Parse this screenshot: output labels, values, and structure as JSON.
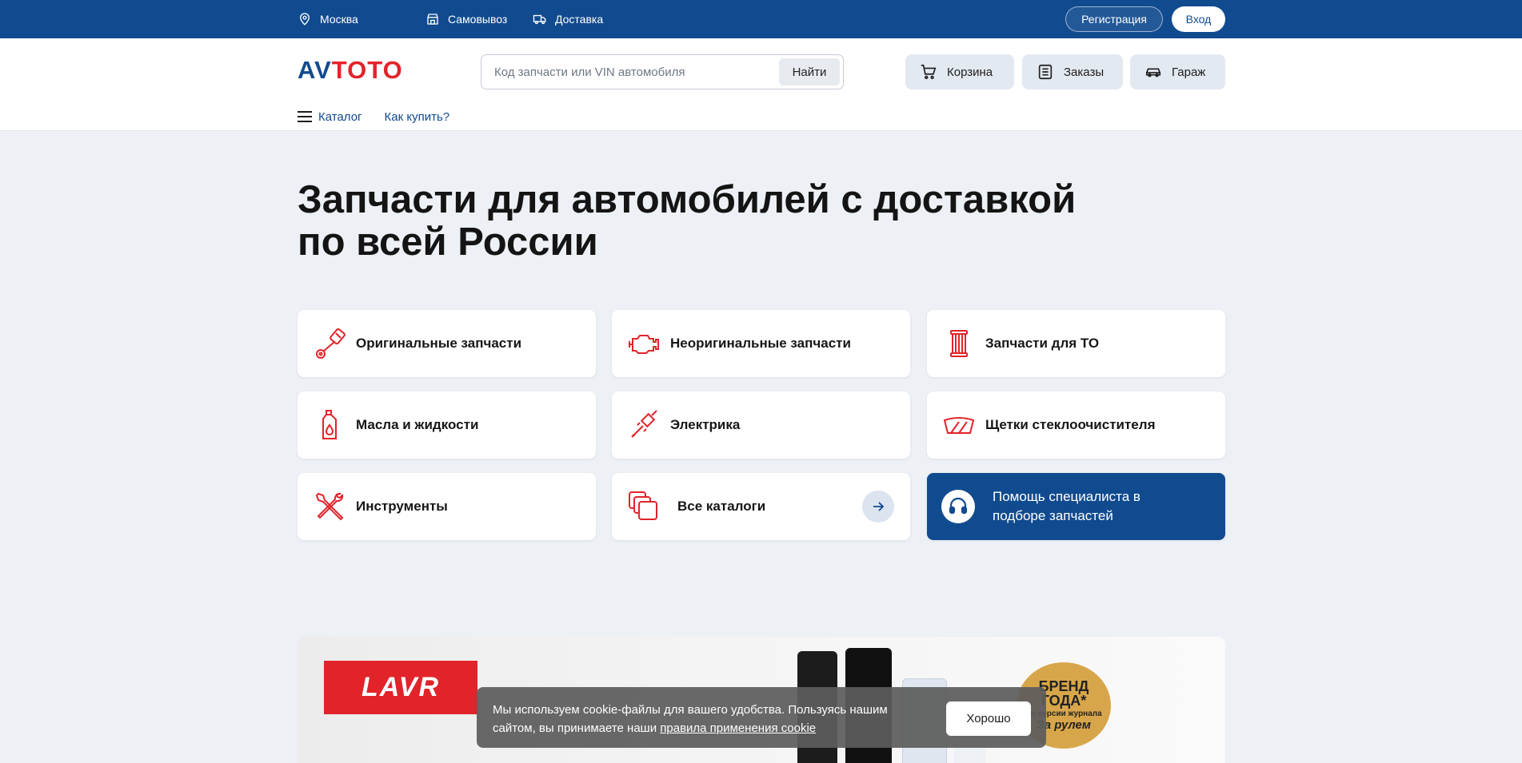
{
  "topbar": {
    "city": "Москва",
    "pickup": "Самовывоз",
    "delivery": "Доставка",
    "register": "Регистрация",
    "login": "Вход"
  },
  "header": {
    "logo_left": "AV",
    "logo_right": "TOTO",
    "search_placeholder": "Код запчасти или VIN автомобиля",
    "search_button": "Найти",
    "cart": "Корзина",
    "orders": "Заказы",
    "garage": "Гараж",
    "catalog": "Каталог",
    "how_to_buy": "Как купить?"
  },
  "hero": {
    "title_line1": "Запчасти для автомобилей с доставкой",
    "title_line2": "по всей России"
  },
  "tiles": [
    {
      "label": "Оригинальные запчасти",
      "icon": "piston-icon"
    },
    {
      "label": "Неоригинальные запчасти",
      "icon": "engine-icon"
    },
    {
      "label": "Запчасти для ТО",
      "icon": "air-filter-icon"
    },
    {
      "label": "Масла и жидкости",
      "icon": "oil-canister-icon"
    },
    {
      "label": "Электрика",
      "icon": "spark-plug-icon"
    },
    {
      "label": "Щетки стеклоочистителя",
      "icon": "windshield-wiper-icon"
    },
    {
      "label": "Инструменты",
      "icon": "tools-icon"
    },
    {
      "label": "Все каталоги",
      "icon": "catalogs-icon"
    },
    {
      "label": "Помощь специалиста в подборе запчастей",
      "icon": "headset-icon"
    }
  ],
  "banner": {
    "brand": "LAVR",
    "badge_line1": "БРЕНД",
    "badge_line2": "ГОДА*",
    "badge_line3": "по версии журнала",
    "badge_line4": "За рулем"
  },
  "cookie": {
    "text": "Мы используем cookie-файлы для вашего удобства. Пользуясь нашим сайтом, вы принимаете наши ",
    "link": "правила применения cookie",
    "button": "Хорошо"
  },
  "colors": {
    "brand_blue": "#114b8f",
    "brand_red": "#e2232a",
    "background": "#edf0f5"
  }
}
